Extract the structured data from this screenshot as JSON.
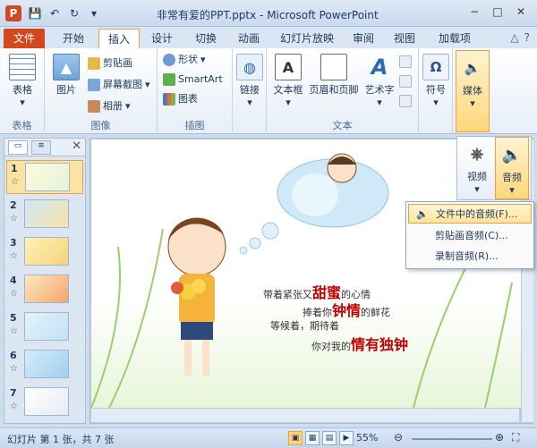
{
  "window": {
    "app_icon": "P",
    "title": "非常有爱的PPT.pptx - Microsoft PowerPoint",
    "minimize": "−",
    "maximize": "□",
    "close": "✕"
  },
  "tabs": [
    {
      "label": "文件"
    },
    {
      "label": "开始"
    },
    {
      "label": "插入"
    },
    {
      "label": "设计"
    },
    {
      "label": "切换"
    },
    {
      "label": "动画"
    },
    {
      "label": "幻灯片放映"
    },
    {
      "label": "审阅"
    },
    {
      "label": "视图"
    },
    {
      "label": "加载项"
    }
  ],
  "active_tab": "插入",
  "ribbon": {
    "groups": {
      "table": "表格",
      "images": "图像",
      "illustrations": "插图",
      "text": "文本"
    },
    "buttons": {
      "table": "表格",
      "picture": "图片",
      "clip_art": "剪贴画",
      "screenshot": "屏幕截图",
      "album": "相册",
      "shapes": "形状",
      "smartart": "SmartArt",
      "chart": "图表",
      "link": "链接",
      "textbox": "文本框",
      "header_footer": "页眉和页脚",
      "wordart": "艺术字",
      "symbol": "符号",
      "media": "媒体"
    }
  },
  "media_panel": {
    "video": "视频",
    "audio": "音频"
  },
  "audio_menu": [
    {
      "label": "文件中的音频(F)..."
    },
    {
      "label": "剪贴画音频(C)..."
    },
    {
      "label": "录制音频(R)..."
    }
  ],
  "slides": [
    {
      "num": "1"
    },
    {
      "num": "2"
    },
    {
      "num": "3"
    },
    {
      "num": "4"
    },
    {
      "num": "5"
    },
    {
      "num": "6"
    },
    {
      "num": "7"
    }
  ],
  "slide_text": {
    "line1_pre": "带着紧张又",
    "line1_hl": "甜蜜",
    "line1_post": "的心情",
    "line2_pre": "捧着你",
    "line2_hl": "钟情",
    "line2_post": "的鲜花",
    "line3": "等候着，期待着",
    "line4_pre": "你对我的",
    "line4_hl": "情有独钟"
  },
  "status": {
    "slide_info": "幻灯片 第 1 张，共 7 张",
    "zoom": "55%"
  },
  "colors": {
    "file_tab": "#d5471d",
    "accent_orange": "#e8a04c",
    "highlight_red": "#c00000"
  }
}
